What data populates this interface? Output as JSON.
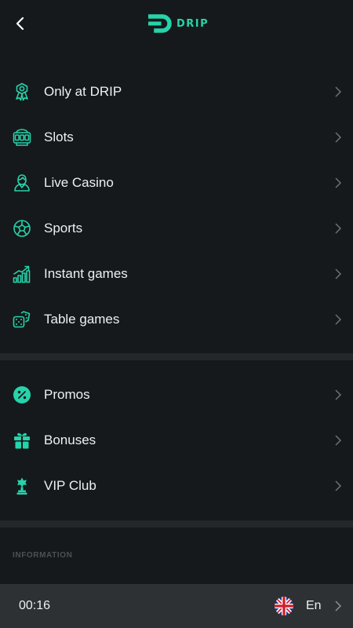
{
  "brand": {
    "name": "DRIP",
    "accent": "#26d3ab"
  },
  "nav": {
    "back_icon": "chevron-left-icon"
  },
  "menu_primary": [
    {
      "key": "only-at-drip",
      "label": "Only at DRIP",
      "icon": "award-icon"
    },
    {
      "key": "slots",
      "label": "Slots",
      "icon": "slot-machine-icon"
    },
    {
      "key": "live-casino",
      "label": "Live Casino",
      "icon": "dealer-icon"
    },
    {
      "key": "sports",
      "label": "Sports",
      "icon": "soccer-ball-icon"
    },
    {
      "key": "instant-games",
      "label": "Instant games",
      "icon": "bar-chart-growth-icon"
    },
    {
      "key": "table-games",
      "label": "Table games",
      "icon": "dice-icon"
    }
  ],
  "menu_secondary": [
    {
      "key": "promos",
      "label": "Promos",
      "icon": "percent-badge-icon"
    },
    {
      "key": "bonuses",
      "label": "Bonuses",
      "icon": "gift-icon"
    },
    {
      "key": "vip-club",
      "label": "VIP Club",
      "icon": "trophy-icon"
    }
  ],
  "information": {
    "heading": "INFORMATION"
  },
  "footer": {
    "time": "00:16",
    "language": "En",
    "flag_icon": "uk-flag-icon"
  }
}
